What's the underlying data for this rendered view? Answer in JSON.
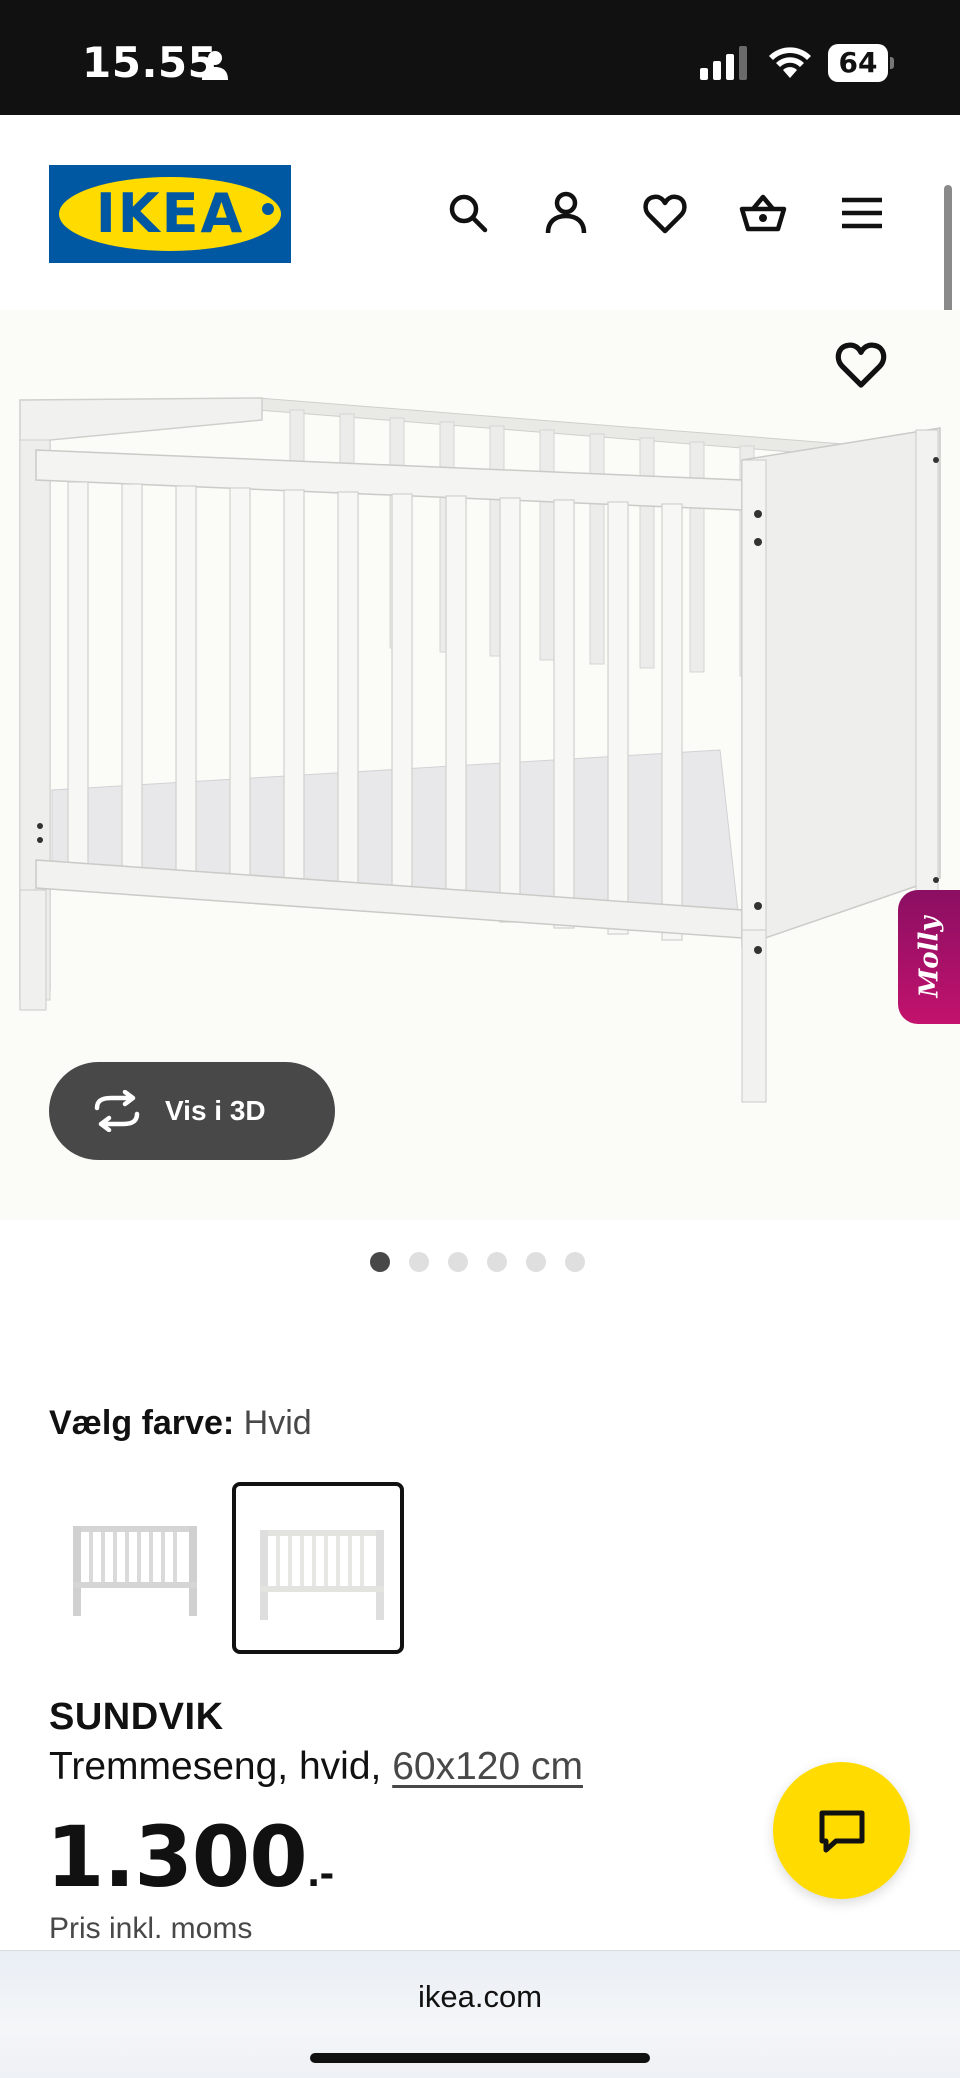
{
  "status_bar": {
    "time": "15.55",
    "battery": "64",
    "icons": [
      "person-icon",
      "cellular-signal-icon",
      "wifi-icon",
      "battery-icon"
    ]
  },
  "header": {
    "logo_text": "IKEA",
    "icons": [
      "search-icon",
      "account-icon",
      "favorites-heart-icon",
      "shopping-basket-icon",
      "menu-icon"
    ]
  },
  "gallery": {
    "view_3d_label": "Vis i 3D",
    "molly_label": "Molly",
    "slide_count": 6,
    "active_slide": 1
  },
  "color_select": {
    "label": "Vælg farve:",
    "value": "Hvid",
    "swatch_count": 2,
    "selected_swatch": 2
  },
  "product": {
    "name": "SUNDVIK",
    "description": "Tremmeseng, hvid,",
    "size": "60x120 cm",
    "price": "1.300",
    "price_suffix": ".-",
    "price_note": "Pris inkl. moms"
  },
  "browser": {
    "url": "ikea.com"
  },
  "colors": {
    "ikea_blue": "#0058a3",
    "ikea_yellow": "#ffdb00",
    "molly_magenta": "#b0126b",
    "status_bar": "#111111"
  }
}
